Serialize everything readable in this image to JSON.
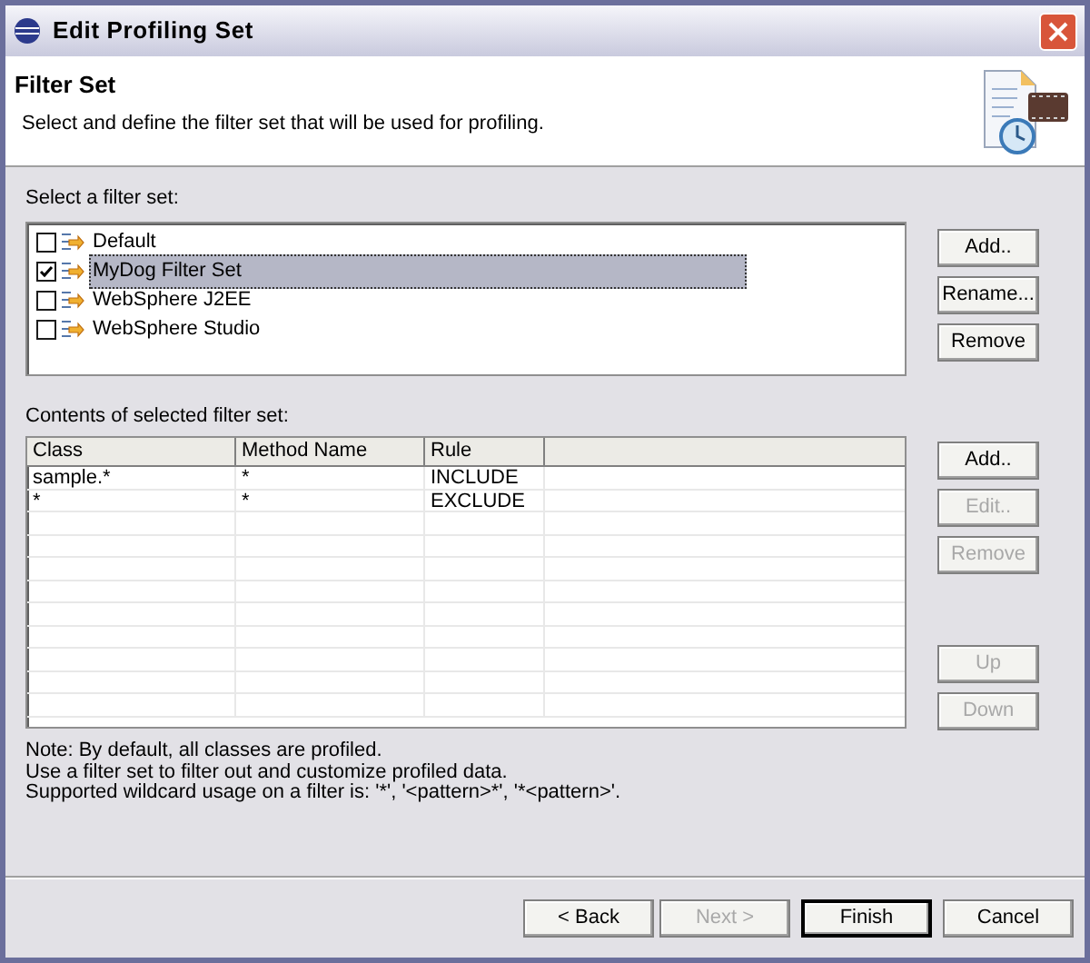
{
  "window": {
    "title": "Edit Profiling Set"
  },
  "header": {
    "title": "Filter Set",
    "description": "Select and define the filter set that will be used for profiling."
  },
  "filter_sets": {
    "label": "Select a filter set:",
    "items": [
      {
        "label": "Default",
        "checked": false,
        "selected": false
      },
      {
        "label": "MyDog Filter Set",
        "checked": true,
        "selected": true
      },
      {
        "label": "WebSphere J2EE",
        "checked": false,
        "selected": false
      },
      {
        "label": "WebSphere Studio",
        "checked": false,
        "selected": false
      }
    ],
    "buttons": [
      {
        "label": "Add..",
        "disabled": false
      },
      {
        "label": "Rename...",
        "disabled": false
      },
      {
        "label": "Remove",
        "disabled": false
      }
    ]
  },
  "contents": {
    "label": "Contents of selected filter set:",
    "columns": [
      "Class",
      "Method Name",
      "Rule"
    ],
    "rows": [
      [
        "sample.*",
        "*",
        "INCLUDE"
      ],
      [
        "*",
        "*",
        "EXCLUDE"
      ]
    ],
    "buttons": [
      {
        "label": "Add..",
        "disabled": false
      },
      {
        "label": "Edit..",
        "disabled": true
      },
      {
        "label": "Remove",
        "disabled": true
      }
    ],
    "order_buttons": [
      {
        "label": "Up",
        "disabled": true
      },
      {
        "label": "Down",
        "disabled": true
      }
    ]
  },
  "notes": [
    "Note: By default, all classes are profiled.",
    "Use a filter set to filter out and customize profiled data.",
    "Supported wildcard usage on a filter is: '*', '<pattern>*', '*<pattern>'."
  ],
  "footer_buttons": [
    {
      "label": "< Back",
      "disabled": false,
      "default": false
    },
    {
      "label": "Next >",
      "disabled": true,
      "default": false
    },
    {
      "label": "Finish",
      "disabled": false,
      "default": true
    },
    {
      "label": "Cancel",
      "disabled": false,
      "default": false
    }
  ]
}
